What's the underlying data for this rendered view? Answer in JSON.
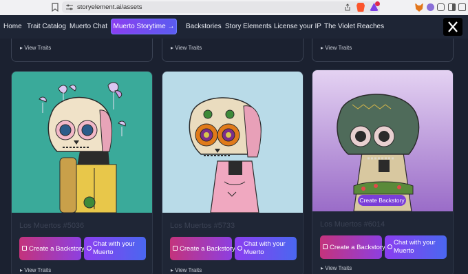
{
  "browser": {
    "url": "storyelement.ai/assets",
    "icons": [
      "bookmark-icon",
      "tune-icon",
      "share-icon",
      "brave-shield-icon",
      "brave-rewards-icon",
      "metamask-icon",
      "extension-icon",
      "puzzle-icon",
      "sidebar-icon",
      "wallet-icon"
    ],
    "rewards_badge_color": "#e0294a"
  },
  "nav": {
    "items": [
      "Home",
      "Trait Catalog",
      "Muerto Chat",
      "Backstories",
      "Story Elements",
      "License your IP",
      "The Violet Reaches"
    ],
    "cta": "Muerto Storytime →",
    "social_icon": "x-logo-icon"
  },
  "top_row": {
    "view_traits": [
      "▸ View Traits",
      "▸ View Traits",
      "▸ View Traits"
    ]
  },
  "cards": [
    {
      "name": "Los Muertos #5036",
      "backstory_label": "Create a Backstory",
      "chat_label": "Chat with your Muerto",
      "view_traits": "▸ View Traits",
      "bg_color": "#3aaa9a"
    },
    {
      "name": "Los Muertos #5733",
      "backstory_label": "Create a Backstory",
      "chat_label": "Chat with your Muerto",
      "view_traits": "▸ View Traits",
      "bg_color": "#b9dbe8"
    },
    {
      "name": "Los Muertos #6014",
      "backstory_label": "Create a Backstory",
      "chat_label": "Chat with your Muerto",
      "view_traits": "▸ View Traits",
      "bg_color": "#c9a8de"
    }
  ],
  "tooltip": "Create Backstory",
  "colors": {
    "page_bg": "#1b2130",
    "accent_purple": "#8b3ef0",
    "accent_pink": "#c4337c",
    "accent_blue": "#4a67f0"
  }
}
